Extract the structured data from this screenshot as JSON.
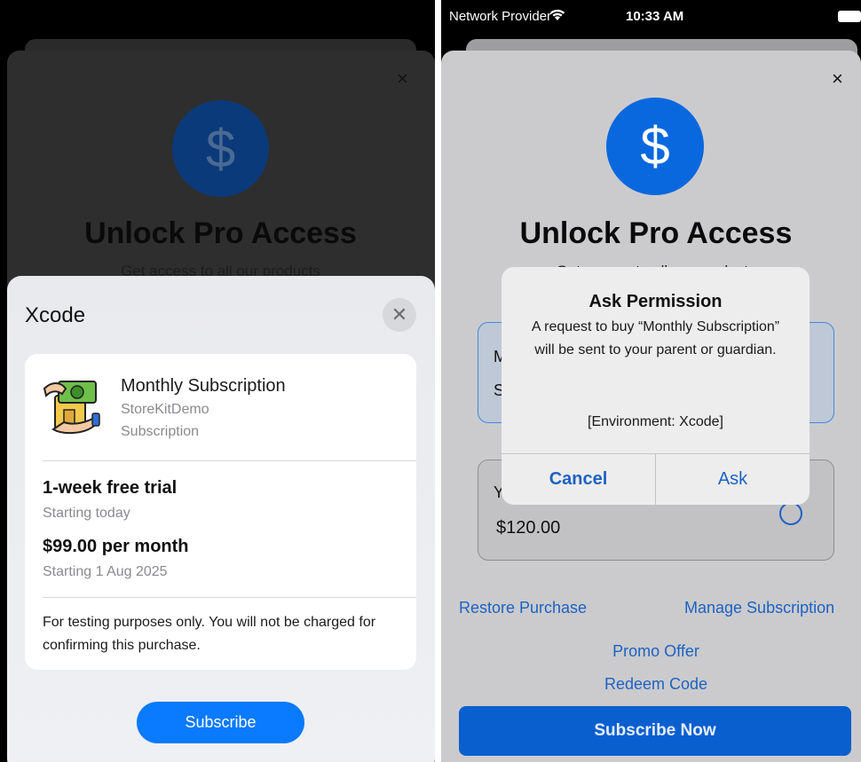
{
  "left": {
    "background": {
      "close_glyph": "×",
      "dollar_glyph": "$",
      "title": "Unlock Pro Access",
      "subtitle": "Get access to all our products"
    },
    "sheet": {
      "title": "Xcode",
      "close_glyph": "✕",
      "product": {
        "name": "Monthly Subscription",
        "app": "StoreKitDemo",
        "type": "Subscription",
        "icon": "money-hand-icon"
      },
      "trial_title": "1-week free trial",
      "trial_subtitle": "Starting today",
      "price_title": "$99.00 per month",
      "price_subtitle": "Starting 1 Aug 2025",
      "note": "For testing purposes only. You will not be charged for confirming this purchase.",
      "subscribe_label": "Subscribe"
    }
  },
  "right": {
    "status_bar": {
      "carrier": "Network Provider",
      "wifi_icon": "wifi-icon",
      "time": "10:33 AM",
      "battery_icon": "battery-icon"
    },
    "close_glyph": "×",
    "dollar_glyph": "$",
    "title": "Unlock Pro Access",
    "subtitle": "Get access to all our products",
    "option1_line1": "M",
    "option1_line2": "S",
    "option2_line1": "Y",
    "option2_price": "$120.00",
    "restore_label": "Restore Purchase",
    "manage_label": "Manage Subscription",
    "promo_label": "Promo Offer",
    "redeem_label": "Redeem Code",
    "subscribe_label": "Subscribe Now",
    "alert": {
      "title": "Ask Permission",
      "message": "A request to buy “Monthly Subscription” will be sent to your parent or guardian.",
      "environment": "[Environment: Xcode]",
      "cancel_label": "Cancel",
      "ask_label": "Ask"
    }
  },
  "colors": {
    "accent_blue": "#0a7aff",
    "link_blue": "#1d62c2",
    "subscribe_now_bg": "#0a5fcf"
  }
}
